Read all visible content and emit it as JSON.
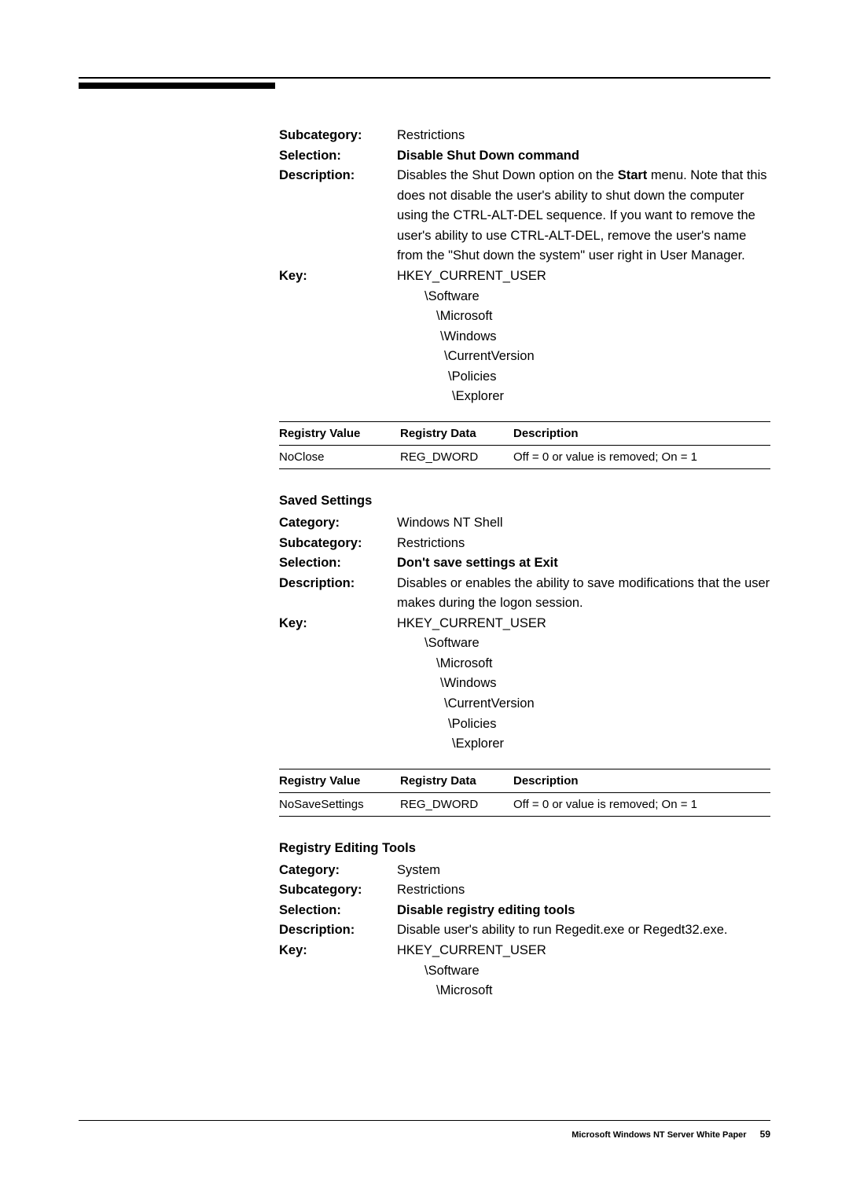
{
  "section1": {
    "subcategory_label": "Subcategory",
    "subcategory": "Restrictions",
    "selection_label": "Selection",
    "selection": "Disable Shut Down command",
    "description_label": "Description",
    "description_prefix": "Disables the Shut Down option on the ",
    "description_bold": "Start",
    "description_suffix": " menu. Note that this does not disable the user's ability to shut down the computer using the CTRL-ALT-DEL sequence. If you want to remove the user's ability to use CTRL-ALT-DEL, remove the user's name from the \"Shut down the system\" user right in User Manager.",
    "key_label": "Key",
    "key_root": "HKEY_CURRENT_USER",
    "key_path": [
      "\\Software",
      "\\Microsoft",
      "\\Windows",
      "\\CurrentVersion",
      "\\Policies",
      "\\Explorer"
    ],
    "table": {
      "h1": "Registry Value",
      "h2": "Registry Data",
      "h3": "Description",
      "r1c1": "NoClose",
      "r1c2": "REG_DWORD",
      "r1c3": "Off = 0 or value is removed; On = 1"
    }
  },
  "section2": {
    "title": "Saved Settings",
    "category_label": "Category:",
    "category": "Windows NT Shell",
    "subcategory_label": "Subcategory",
    "subcategory": "Restrictions",
    "selection_label": "Selection",
    "selection": "Don't save settings at Exit",
    "description_label": "Description",
    "description": "Disables or enables the ability to save modifications that the user makes during the logon session.",
    "key_label": "Key",
    "key_root": "HKEY_CURRENT_USER",
    "key_path": [
      "\\Software",
      "\\Microsoft",
      "\\Windows",
      "\\CurrentVersion",
      "\\Policies",
      "\\Explorer"
    ],
    "table": {
      "h1": "Registry Value",
      "h2": "Registry Data",
      "h3": "Description",
      "r1c1": "NoSaveSettings",
      "r1c2": "REG_DWORD",
      "r1c3": "Off = 0 or value is removed; On = 1"
    }
  },
  "section3": {
    "title": "Registry Editing Tools",
    "category_label": "Category:",
    "category": "System",
    "subcategory_label": "Subcategory",
    "subcategory": "Restrictions",
    "selection_label": "Selection",
    "selection": "Disable registry editing tools",
    "description_label": "Description",
    "description": "Disable user's ability to run Regedit.exe or Regedt32.exe.",
    "key_label": "Key",
    "key_root": "HKEY_CURRENT_USER",
    "key_path": [
      "\\Software",
      "\\Microsoft"
    ]
  },
  "footer": {
    "text": "Microsoft Windows NT Server White Paper",
    "page": "59"
  }
}
